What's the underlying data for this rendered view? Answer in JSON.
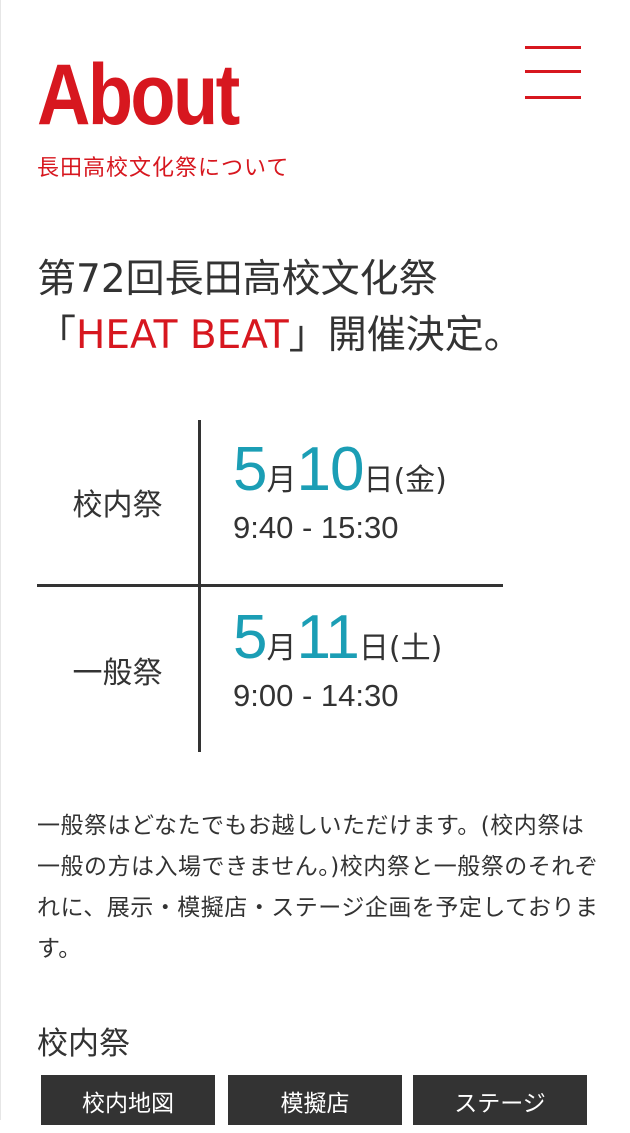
{
  "header": {
    "title": "About",
    "subtitle": "長田高校文化祭について",
    "menu_icon": "hamburger-menu-icon"
  },
  "headline": {
    "line1": "第72回長田高校文化祭",
    "open_bracket": "「",
    "theme": "HEAT BEAT",
    "close_rest": "」開催決定。"
  },
  "schedule": [
    {
      "label": "校内祭",
      "month": "5",
      "month_unit": "月",
      "day": "10",
      "day_unit": "日",
      "weekday": "(金)",
      "time": "9:40 - 15:30"
    },
    {
      "label": "一般祭",
      "month": "5",
      "month_unit": "月",
      "day": "11",
      "day_unit": "日",
      "weekday": "(土)",
      "time": "9:00 - 14:30"
    }
  ],
  "description": "一般祭はどなたでもお越しいただけます。(校内祭は一般の方は入場できません。)校内祭と一般祭のそれぞれに、展示・模擬店・ステージ企画を予定しております。",
  "section": {
    "title": "校内祭",
    "tabs": [
      "校内地図",
      "模擬店",
      "ステージ"
    ]
  },
  "colors": {
    "accent_red": "#d7171f",
    "date_teal": "#1b9eb5",
    "text": "#333333",
    "tab_bg": "#333333"
  }
}
